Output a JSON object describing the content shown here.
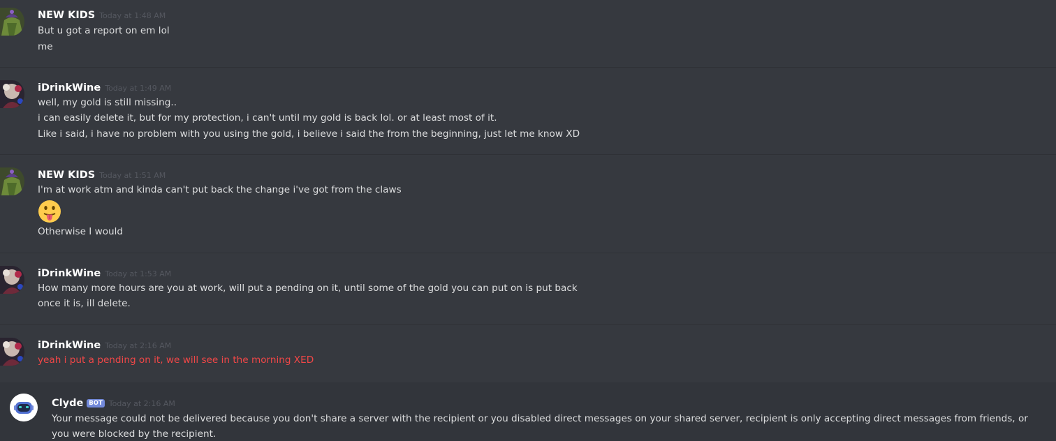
{
  "messages": [
    {
      "author": "NEW KIDS",
      "timestamp": "Today at 1:48 AM",
      "lines": [
        "But u got a report on em lol",
        "me"
      ]
    },
    {
      "author": "iDrinkWine",
      "timestamp": "Today at 1:49 AM",
      "lines": [
        "well, my gold is still missing..",
        "i can easily delete it, but for my protection, i can't until my gold is back lol. or at least most of it.",
        "Like i said, i have no problem with you using the gold, i believe i said the from the beginning, just let me know XD"
      ]
    },
    {
      "author": "NEW KIDS",
      "timestamp": "Today at 1:51 AM",
      "lines": [
        "I'm at work atm and kinda can't put back the change i've got from the claws",
        "Otherwise I would"
      ],
      "emoji": "stuck-out-tongue-emoji"
    },
    {
      "author": "iDrinkWine",
      "timestamp": "Today at 1:53 AM",
      "lines": [
        "How many more hours are you at work, will put a pending on it, until some of the gold you can put on is put back",
        "once it is, ill delete."
      ]
    },
    {
      "author": "iDrinkWine",
      "timestamp": "Today at 2:16 AM",
      "lines": [
        "yeah i put a pending on it, we will see in the morning XED"
      ],
      "status": "failed",
      "status_color": "#f04747"
    }
  ],
  "system_message": {
    "author": "Clyde",
    "badge": "BOT",
    "timestamp": "Today at 2:16 AM",
    "text": "Your message could not be delivered because you don't share a server with the recipient or you disabled direct messages on your shared server, recipient is only accepting direct messages from friends, or you were blocked by the recipient."
  },
  "colors": {
    "background": "#36393f",
    "username": "#ffffff",
    "timestamp": "#555860",
    "text": "#dcddde",
    "error": "#f04747",
    "bot_badge": "#7289da"
  }
}
